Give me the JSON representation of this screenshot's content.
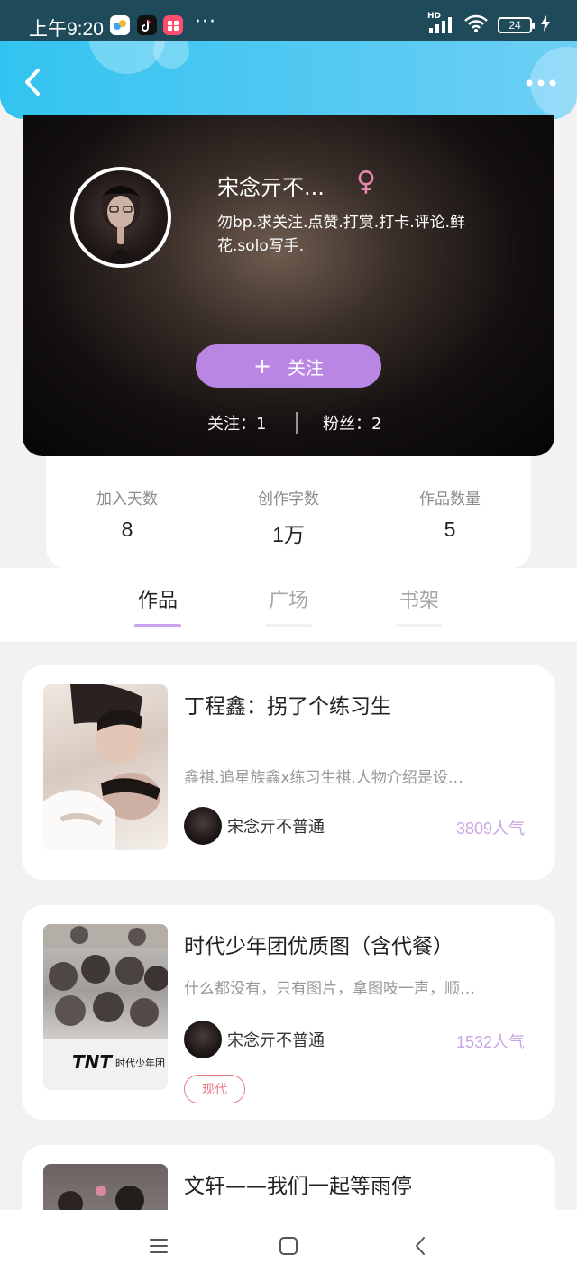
{
  "status_bar": {
    "time": "上午9:20",
    "more": "···",
    "network": "HD",
    "battery": "24"
  },
  "header": {
    "back_icon": "chevron-left-icon",
    "more_icon": "more-horizontal-icon"
  },
  "profile": {
    "nickname": "宋念亓不...",
    "gender_symbol": "♀",
    "bio": "勿bp.求关注.点赞.打赏.打卡.评论.鲜花.solo写手.",
    "follow_plus": "+",
    "follow_label": "关注",
    "following": "关注：1",
    "fans": "粉丝：2"
  },
  "stats": [
    {
      "label": "加入天数",
      "value": "8"
    },
    {
      "label": "创作字数",
      "value": "1万"
    },
    {
      "label": "作品数量",
      "value": "5"
    }
  ],
  "tabs": [
    {
      "label": "作品",
      "active": true
    },
    {
      "label": "广场",
      "active": false
    },
    {
      "label": "书架",
      "active": false
    }
  ],
  "works": [
    {
      "title": "丁程鑫：拐了个练习生",
      "desc": "鑫祺.追星族鑫x练习生祺.人物介绍是设…",
      "author": "宋念亓不普通",
      "popularity": "3809人气"
    },
    {
      "title": "时代少年团优质图（含代餐）",
      "desc": "什么都没有，只有图片，拿图吱一声，顺…",
      "author": "宋念亓不普通",
      "popularity": "1532人气",
      "tag": "现代"
    },
    {
      "title": "文轩——我们一起等雨停"
    }
  ],
  "colors": {
    "header": "#3ec6f1",
    "accent_purple": "#b987e3",
    "popularity": "#c9a5e6",
    "tag_red": "#e77b86",
    "gender_pink": "#e987a9"
  }
}
